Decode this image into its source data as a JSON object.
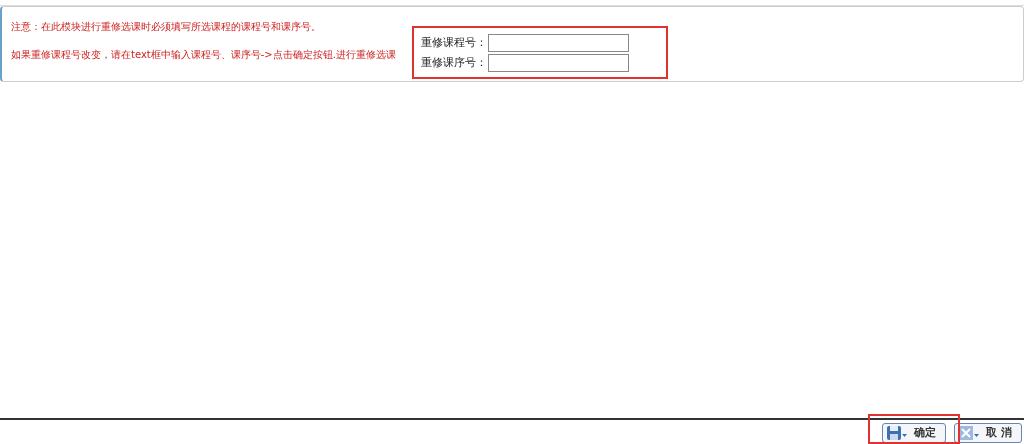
{
  "notices": [
    "注意：在此模块进行重修选课时必须填写所选课程的课程号和课序号。",
    "如果重修课程号改变，请在text框中输入课程号、课序号->点击确定按钮.进行重修选课"
  ],
  "fields": [
    {
      "label": "重修课程号："
    },
    {
      "label": "重修课序号："
    }
  ],
  "buttons": [
    {
      "label": "确定",
      "kind": "save"
    },
    {
      "label": "取 消",
      "kind": "cancel"
    }
  ]
}
